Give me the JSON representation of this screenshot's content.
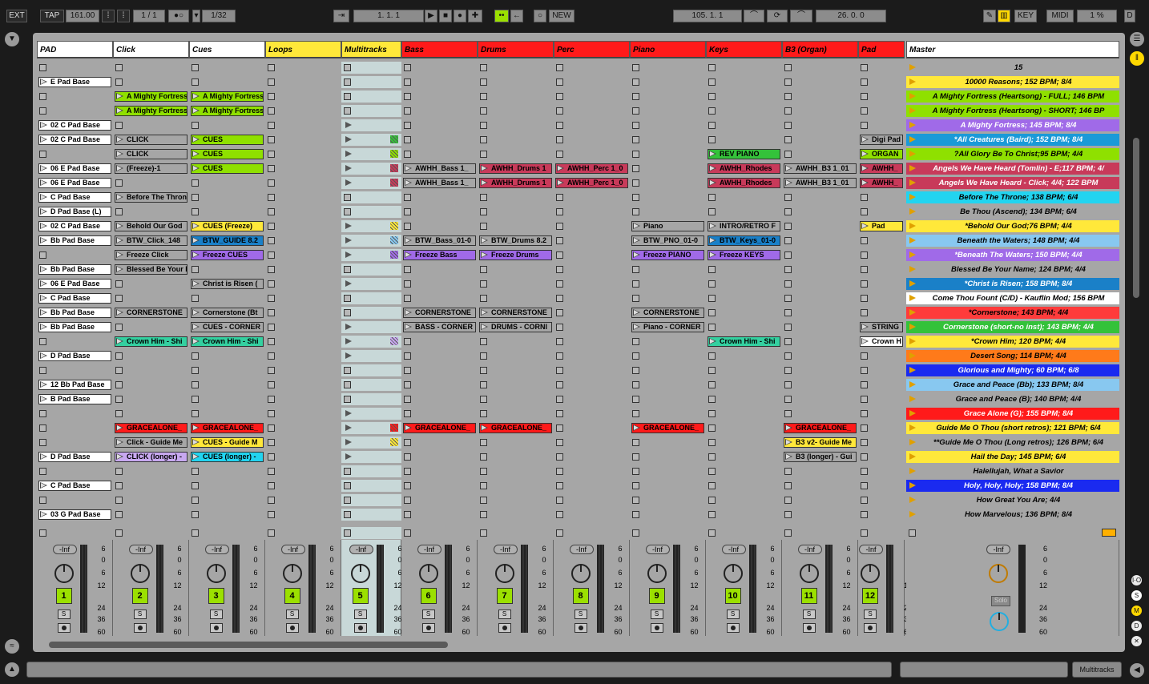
{
  "transport": {
    "ext": "EXT",
    "tap": "TAP",
    "tempo": "161.00",
    "sig": "1 / 1",
    "quant": "1/32",
    "pos": "1.   1.   1",
    "new": "NEW",
    "loop_start": "105.   1.   1",
    "loop_len": "26.   0.   0",
    "key": "KEY",
    "midi": "MIDI",
    "cpu": "1 %",
    "d": "D",
    "metro_icon": "metronome-icon",
    "record_icon": "record-icon"
  },
  "tracks": [
    {
      "name": "PAD",
      "color": "#ffffff"
    },
    {
      "name": "Click",
      "color": "#ffffff"
    },
    {
      "name": "Cues",
      "color": "#ffffff"
    },
    {
      "name": "Loops",
      "color": "#ffe83a"
    },
    {
      "name": "Multitracks",
      "color": "#ffe83a"
    },
    {
      "name": "Bass",
      "color": "#ff1a1a"
    },
    {
      "name": "Drums",
      "color": "#ff1a1a"
    },
    {
      "name": "Perc",
      "color": "#ff1a1a"
    },
    {
      "name": "Piano",
      "color": "#ff1a1a"
    },
    {
      "name": "Keys",
      "color": "#ff1a1a"
    },
    {
      "name": "B3 (Organ)",
      "color": "#ff1a1a"
    },
    {
      "name": "Pad",
      "color": "#ff1a1a"
    }
  ],
  "master": {
    "name": "Master",
    "top_label": "15",
    "solo": "Solo"
  },
  "clips": {
    "PAD": {
      "1": "E Pad Base",
      "4": "02 C Pad Base",
      "5": "02 C Pad Base",
      "7": "06 E Pad Base",
      "8": "06 E Pad Base",
      "9": "C Pad Base",
      "10": "D Pad Base (L)",
      "11": "02 C Pad Base",
      "12": "Bb Pad Base",
      "14": "Bb Pad Base",
      "15": "06 E Pad Base",
      "16": "C Pad Base",
      "17": "Bb Pad Base",
      "18": "Bb Pad Base",
      "20": "D Pad Base",
      "22": "12 Bb Pad Base",
      "23": "B Pad Base",
      "27": "D Pad Base",
      "29": "C Pad Base",
      "31": "03 G Pad Base"
    },
    "Click": {
      "2": "A Mighty Fortress",
      "3": "A Mighty Fortress",
      "5": "CLICK",
      "6": "CLICK",
      "7": "(Freeze)-1",
      "9": "Before The Throne",
      "11": "Behold Our God",
      "12": "BTW_Click_148",
      "13": "Freeze Click",
      "14": "Blessed Be Your Name",
      "17": "CORNERSTONE",
      "19": "Crown Him - Shi",
      "25": "GRACEALONE_",
      "26": "Click - Guide Me",
      "27": "CLICK (longer) -"
    },
    "Cues": {
      "2": "A Mighty Fortress",
      "3": "A Mighty Fortress",
      "5": "CUES",
      "6": "CUES",
      "7": "CUES",
      "11": "CUES (Freeze)",
      "12": "BTW_GUIDE 8.2",
      "13": "Freeze CUES",
      "15": "Christ is Risen (",
      "17": "Cornerstone (Bt",
      "18": "CUES - CORNER",
      "19": "Crown Him - Shi",
      "25": "GRACEALONE_",
      "26": "CUES - Guide M",
      "27": "CUES (longer) -"
    },
    "Bass": {
      "7": "AWHH_Bass 1_",
      "8": "AWHH_Bass 1_",
      "12": "BTW_Bass_01-0",
      "13": "Freeze Bass",
      "17": "CORNERSTONE",
      "18": "BASS - CORNER",
      "25": "GRACEALONE_"
    },
    "Drums": {
      "7": "AWHH_Drums 1",
      "8": "AWHH_Drums 1",
      "12": "BTW_Drums 8.2",
      "13": "Freeze Drums",
      "17": "CORNERSTONE",
      "18": "DRUMS - CORNI",
      "25": "GRACEALONE_"
    },
    "Perc": {
      "7": "AWHH_Perc 1_0",
      "8": "AWHH_Perc 1_0"
    },
    "Piano": {
      "11": "Piano",
      "12": "BTW_PNO_01-0",
      "13": "Freeze PIANO",
      "17": "CORNERSTONE",
      "18": "Piano - CORNER",
      "25": "GRACEALONE_"
    },
    "Keys": {
      "6": "REV PIANO",
      "7": "AWHH_Rhodes",
      "8": "AWHH_Rhodes",
      "11": "INTRO/RETRO F",
      "12": "BTW_Keys_01-0",
      "13": "Freeze KEYS",
      "19": "Crown Him - Shi"
    },
    "B3 (Organ)": {
      "7": "AWHH_B3 1_01",
      "8": "AWHH_B3 1_01",
      "25": "GRACEALONE_",
      "26": "B3 v2- Guide Me",
      "27": "B3 (longer) - Gui"
    },
    "Pad": {
      "5": "Digi Pad",
      "6": "ORGAN",
      "7": "AWHH_",
      "8": "AWHH_",
      "11": "Pad",
      "18": "STRING",
      "19": "Crown H"
    }
  },
  "scenes": [
    {
      "name": "10000 Reasons; 152 BPM; 8/4",
      "color": "#ffe83a"
    },
    {
      "name": "A Mighty Fortress (Heartsong) - FULL; 146 BPM",
      "color": "#8fe000"
    },
    {
      "name": "A Mighty Fortress (Heartsong) - SHORT; 146 BP",
      "color": "#8fe000"
    },
    {
      "name": "A Mighty Fortress; 145 BPM; 8/4",
      "color": "#a06ae8"
    },
    {
      "name": "*All Creatures (Baird); 152 BPM; 8/4",
      "color": "#1a9ad8"
    },
    {
      "name": "?All Glory Be To Christ;95 BPM; 4/4",
      "color": "#8fe000"
    },
    {
      "name": "Angels We Have Heard (Tomlin) - E;117 BPM; 4/",
      "color": "#c83a5a"
    },
    {
      "name": "Angels We Have Heard - Click; 4/4; 122 BPM",
      "color": "#c83a5a"
    },
    {
      "name": "Before The Throne; 138 BPM; 6/4",
      "color": "#22d4f0"
    },
    {
      "name": "Be Thou (Ascend); 134 BPM; 6/4",
      "color": "#a6a6a6"
    },
    {
      "name": "*Behold Our God;76 BPM; 4/4",
      "color": "#ffe83a"
    },
    {
      "name": "Beneath the Waters; 148 BPM; 4/4",
      "color": "#88c8f0"
    },
    {
      "name": "*Beneath The Waters; 150 BPM; 4/4",
      "color": "#a06ae8"
    },
    {
      "name": "Blessed Be Your Name; 124 BPM; 4/4",
      "color": "#a6a6a6"
    },
    {
      "name": "*Christ is Risen; 158 BPM; 8/4",
      "color": "#1a80c8"
    },
    {
      "name": "Come Thou Fount (C/D) - Kauflin Mod; 156 BPM",
      "color": "#ffffff"
    },
    {
      "name": "*Cornerstone; 143 BPM; 4/4",
      "color": "#ff3b3b"
    },
    {
      "name": "Cornerstone (short-no inst); 143 BPM; 4/4",
      "color": "#34c23a"
    },
    {
      "name": "*Crown Him; 120 BPM; 4/4",
      "color": "#ffe83a"
    },
    {
      "name": "Desert Song; 114 BPM; 4/4",
      "color": "#ff7a1a"
    },
    {
      "name": "Glorious and Mighty; 60 BPM; 6/8",
      "color": "#1a2af0"
    },
    {
      "name": "Grace and Peace (Bb); 133 BPM; 8/4",
      "color": "#88c8f0"
    },
    {
      "name": "Grace and Peace (B); 140 BPM; 4/4",
      "color": "#a6a6a6"
    },
    {
      "name": "Grace Alone (G); 155 BPM; 8/4",
      "color": "#ff1a1a"
    },
    {
      "name": "Guide Me O Thou (short retros); 121 BPM; 6/4",
      "color": "#ffe83a"
    },
    {
      "name": "**Guide Me O Thou (Long retros); 126 BPM; 6/4",
      "color": "#a6a6a6"
    },
    {
      "name": "Hail the Day; 145 BPM; 6/4",
      "color": "#ffe83a"
    },
    {
      "name": "Halellujah, What a Savior",
      "color": "#a6a6a6"
    },
    {
      "name": "Holy, Holy, Holy; 158 BPM; 8/4",
      "color": "#1a2af0"
    },
    {
      "name": "How Great You Are; 4/4",
      "color": "#a6a6a6"
    },
    {
      "name": "How Marvelous; 136 BPM; 8/4",
      "color": "#a6a6a6"
    }
  ],
  "mixer": {
    "vol": "-Inf",
    "s": "S",
    "scale": [
      "6",
      "0",
      "6",
      "12",
      "24",
      "36",
      "60"
    ]
  },
  "status": {
    "track_label": "Multitracks"
  }
}
